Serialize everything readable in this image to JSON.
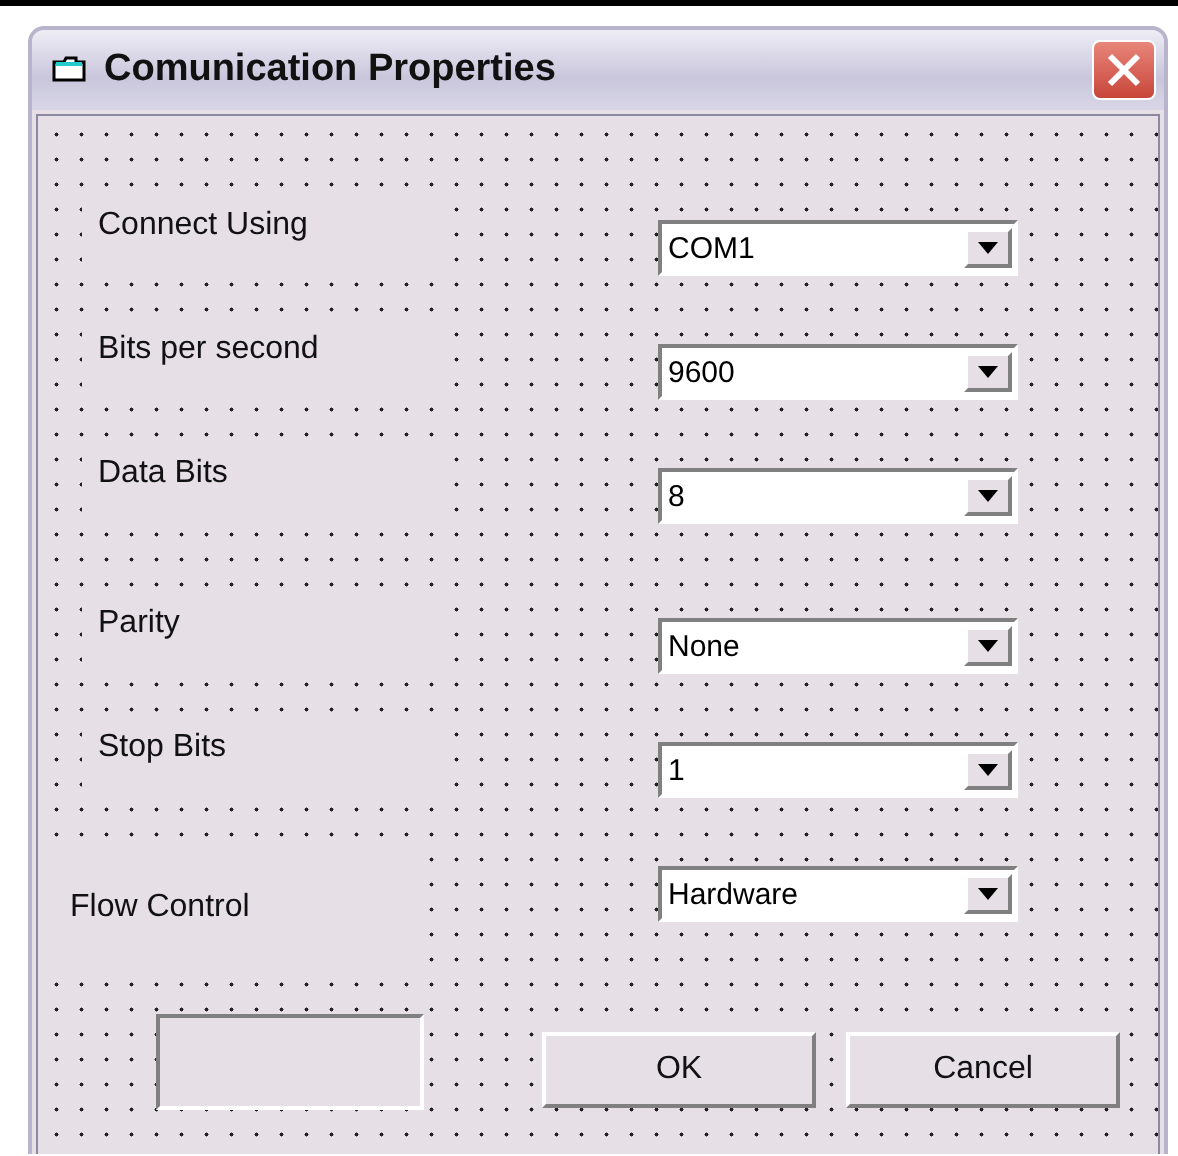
{
  "window": {
    "title": "Comunication Properties"
  },
  "settings": [
    {
      "label": "Connect Using",
      "value": "COM1"
    },
    {
      "label": "Bits per second",
      "value": "9600"
    },
    {
      "label": "Data Bits",
      "value": "8"
    },
    {
      "label": "Parity",
      "value": "None"
    },
    {
      "label": "Stop Bits",
      "value": "1"
    },
    {
      "label": "Flow Control",
      "value": "Hardware"
    }
  ],
  "buttons": [
    "OK",
    "Cancel"
  ]
}
